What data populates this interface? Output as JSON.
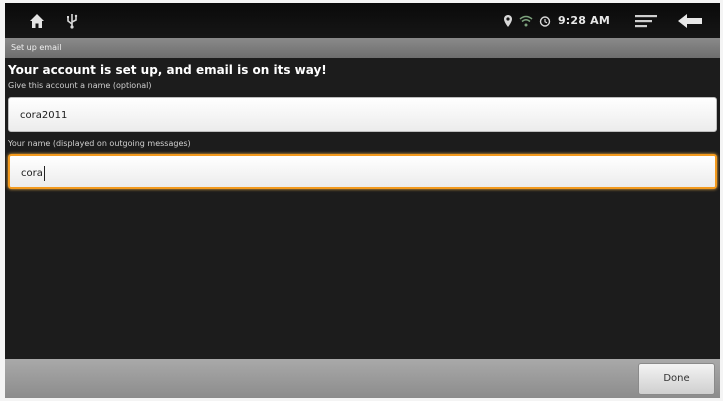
{
  "status_bar": {
    "time": "9:28 AM",
    "icons": [
      "home-icon",
      "usb-icon",
      "location-icon",
      "wifi-icon",
      "alarm-icon",
      "menu-icon",
      "back-icon"
    ]
  },
  "title_bar": {
    "title": "Set up email"
  },
  "form": {
    "headline": "Your account is set up, and email is on its way!",
    "account_name_label": "Give this account a name (optional)",
    "account_name_value": "cora2011",
    "your_name_label": "Your name (displayed on outgoing messages)",
    "your_name_value": "cora"
  },
  "bottom_bar": {
    "done_label": "Done"
  },
  "colors": {
    "focus_border": "#f39a1e",
    "background": "#1c1c1c",
    "title_bar": "#7c7c7c"
  }
}
